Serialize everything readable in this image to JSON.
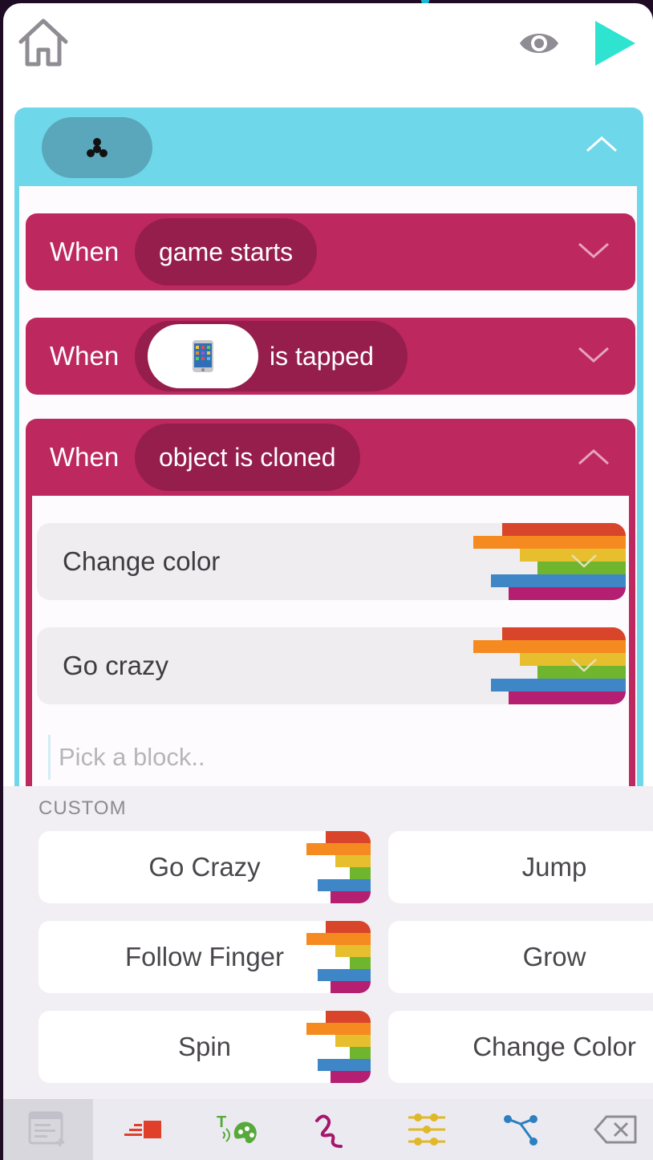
{
  "top_bar": {
    "home_icon": "home-icon",
    "preview_icon": "eye-icon",
    "play_icon": "play-icon"
  },
  "object": {
    "icon": "fidget-spinner-icon",
    "collapse_icon": "chevron-up-icon"
  },
  "rules": [
    {
      "when": "When",
      "trigger": "game starts"
    },
    {
      "when": "When",
      "trigger_icon": "phone-emoji",
      "trigger": "is tapped"
    },
    {
      "when": "When",
      "trigger": "object is cloned"
    }
  ],
  "actions": [
    {
      "label": "Change color"
    },
    {
      "label": "Go crazy"
    }
  ],
  "pick_placeholder": "Pick a block..",
  "palette": {
    "section_title": "CUSTOM",
    "cards": [
      {
        "label": "Go Crazy"
      },
      {
        "label": "Jump"
      },
      {
        "label": "Follow Finger"
      },
      {
        "label": "Grow"
      },
      {
        "label": "Spin"
      },
      {
        "label": "Change Color"
      }
    ]
  },
  "tabs": [
    {
      "icon": "add-block-icon",
      "active": true
    },
    {
      "icon": "motion-block-icon"
    },
    {
      "icon": "text-paint-icon"
    },
    {
      "icon": "draw-squiggle-icon"
    },
    {
      "icon": "sliders-icon"
    },
    {
      "icon": "branch-icon"
    },
    {
      "icon": "backspace-icon"
    }
  ],
  "colors": {
    "accent": "#6fd7ea",
    "rule": "#bd285f",
    "rule_pill": "#961e4d",
    "play": "#2fe3d1"
  }
}
